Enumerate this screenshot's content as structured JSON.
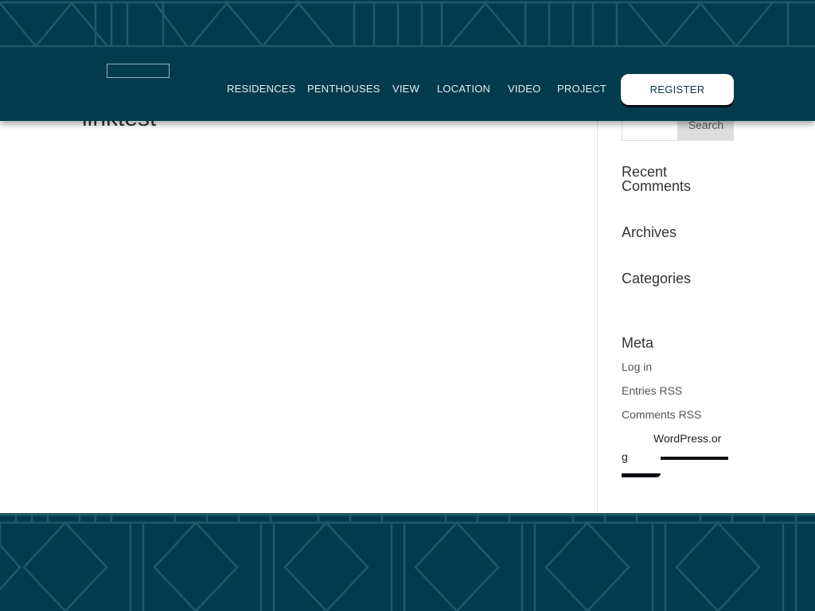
{
  "header": {
    "nav": [
      "RESIDENCES",
      "PENTHOUSES",
      "VIEW",
      "LOCATION",
      "VIDEO",
      "PROJECT"
    ],
    "register_label": "REGISTER"
  },
  "main": {
    "post_title": "linktest"
  },
  "sidebar": {
    "search_button_label": "Search",
    "search_input_value": "",
    "widgets": [
      "Recent Comments",
      "Archives",
      "Categories",
      "Meta"
    ],
    "meta_links": [
      "Log in",
      "Entries RSS",
      "Comments RSS"
    ],
    "wordpress_link_part1": "WordPress.or",
    "wordpress_link_part2": "g"
  },
  "colors": {
    "brand": "#033b4e",
    "pattern_line": "#1f5a6c",
    "accent_dark": "#0b0f14"
  }
}
